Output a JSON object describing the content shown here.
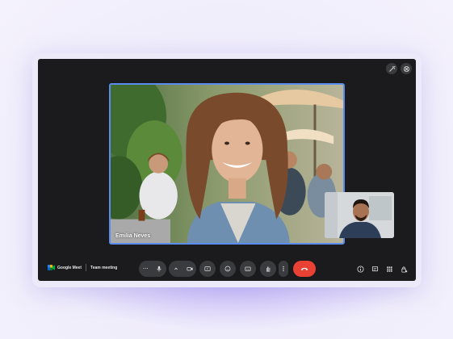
{
  "app": {
    "brand_name": "Google Meet",
    "meeting_title": "Team meeting"
  },
  "participants": {
    "main_speaker_name": "Emilia Neves"
  },
  "controls": {
    "more_options_glyph": "⋯",
    "mic_icon": "mic-icon",
    "camera_icon": "camera-icon",
    "present_icon": "present-screen-icon",
    "reactions_icon": "emoji-icon",
    "captions_icon": "captions-icon",
    "raise_hand_icon": "raise-hand-icon",
    "overflow_icon": "more-vert-icon",
    "end_call_icon": "end-call-icon"
  },
  "right_panel": {
    "icons": [
      "info-icon",
      "chat-icon",
      "activities-icon",
      "host-controls-icon"
    ]
  },
  "colors": {
    "accent_border": "#5b8def",
    "end_call": "#e94235",
    "control_bg": "#3a3b3e",
    "screen_bg": "#1b1b1d"
  }
}
